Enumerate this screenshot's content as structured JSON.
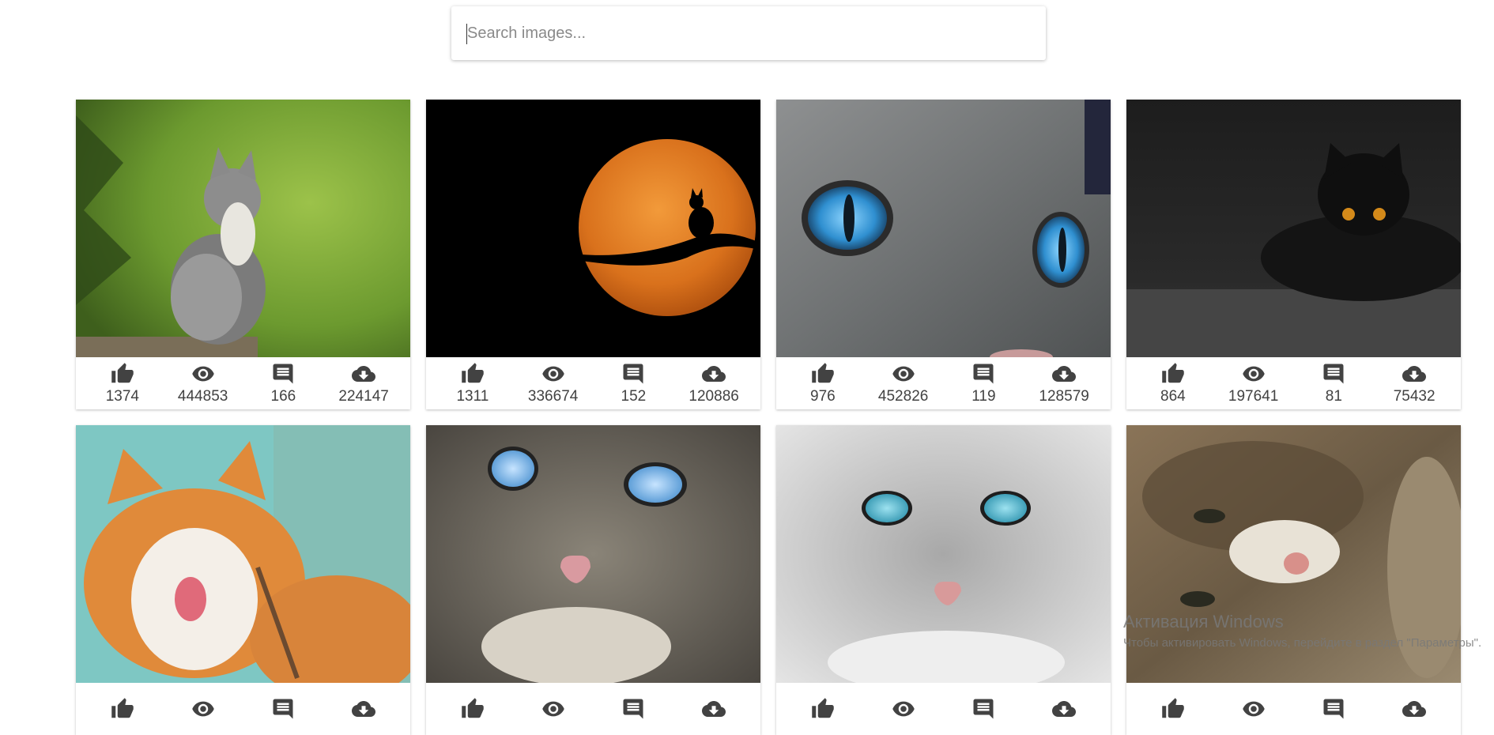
{
  "search": {
    "placeholder": "Search images..."
  },
  "images": [
    {
      "likes": "1374",
      "views": "444853",
      "comments": "166",
      "downloads": "224147"
    },
    {
      "likes": "1311",
      "views": "336674",
      "comments": "152",
      "downloads": "120886"
    },
    {
      "likes": "976",
      "views": "452826",
      "comments": "119",
      "downloads": "128579"
    },
    {
      "likes": "864",
      "views": "197641",
      "comments": "81",
      "downloads": "75432"
    },
    {},
    {},
    {},
    {}
  ],
  "icons": {
    "likes": "thumb-up-icon",
    "views": "eye-icon",
    "comments": "comment-icon",
    "downloads": "cloud-download-icon"
  },
  "watermark": {
    "title": "Активация Windows",
    "subtitle": "Чтобы активировать Windows, перейдите в раздел \"Параметры\"."
  }
}
